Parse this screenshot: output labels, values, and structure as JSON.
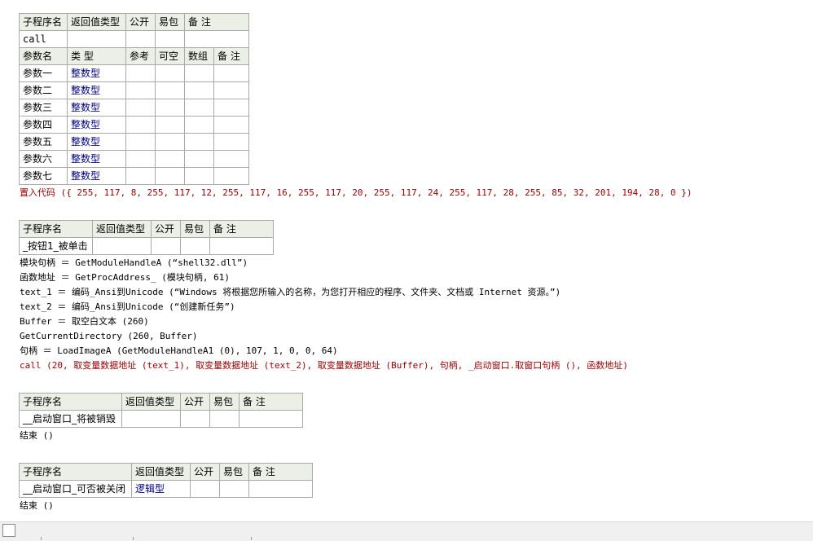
{
  "sub1": {
    "header": [
      "子程序名",
      "返回值类型",
      "公开",
      "易包",
      "备 注"
    ],
    "name": "call",
    "param_header": [
      "参数名",
      "类 型",
      "参考",
      "可空",
      "数组",
      "备 注"
    ],
    "params": [
      {
        "name": "参数一",
        "type": "整数型"
      },
      {
        "name": "参数二",
        "type": "整数型"
      },
      {
        "name": "参数三",
        "type": "整数型"
      },
      {
        "name": "参数四",
        "type": "整数型"
      },
      {
        "name": "参数五",
        "type": "整数型"
      },
      {
        "name": "参数六",
        "type": "整数型"
      },
      {
        "name": "参数七",
        "type": "整数型"
      }
    ],
    "code": "置入代码 ({ 255, 117, 8, 255, 117, 12, 255, 117, 16, 255, 117, 20, 255, 117, 24, 255, 117, 28, 255, 85, 32, 201, 194, 28, 0 })"
  },
  "sub2": {
    "header": [
      "子程序名",
      "返回值类型",
      "公开",
      "易包",
      "备 注"
    ],
    "name": "_按钮1_被单击",
    "lines": [
      "模块句柄 ＝ GetModuleHandleA (“shell32.dll”)",
      "函数地址 ＝ GetProcAddress_ (模块句柄, 61)",
      "text_1 ＝ 编码_Ansi到Unicode (“Windows 将根据您所输入的名称，为您打开相应的程序、文件夹、文档或 Internet 资源。”)",
      "text_2 ＝ 编码_Ansi到Unicode (“创建新任务”)",
      "Buffer ＝ 取空白文本 (260)",
      "GetCurrentDirectory (260, Buffer)",
      "句柄 ＝ LoadImageA (GetModuleHandleA1 (0), 107, 1, 0, 0, 64)",
      "call (20, 取变量数据地址 (text_1), 取变量数据地址 (text_2), 取变量数据地址 (Buffer), 句柄, _启动窗口.取窗口句柄 (), 函数地址)"
    ]
  },
  "sub3": {
    "header": [
      "子程序名",
      "返回值类型",
      "公开",
      "易包",
      "备 注"
    ],
    "name": "__启动窗口_将被销毁",
    "return_type": "",
    "code": "结束 ()"
  },
  "sub4": {
    "header": [
      "子程序名",
      "返回值类型",
      "公开",
      "易包",
      "备 注"
    ],
    "name": "__启动窗口_可否被关闭",
    "return_type": "逻辑型",
    "code": "结束 ()"
  }
}
